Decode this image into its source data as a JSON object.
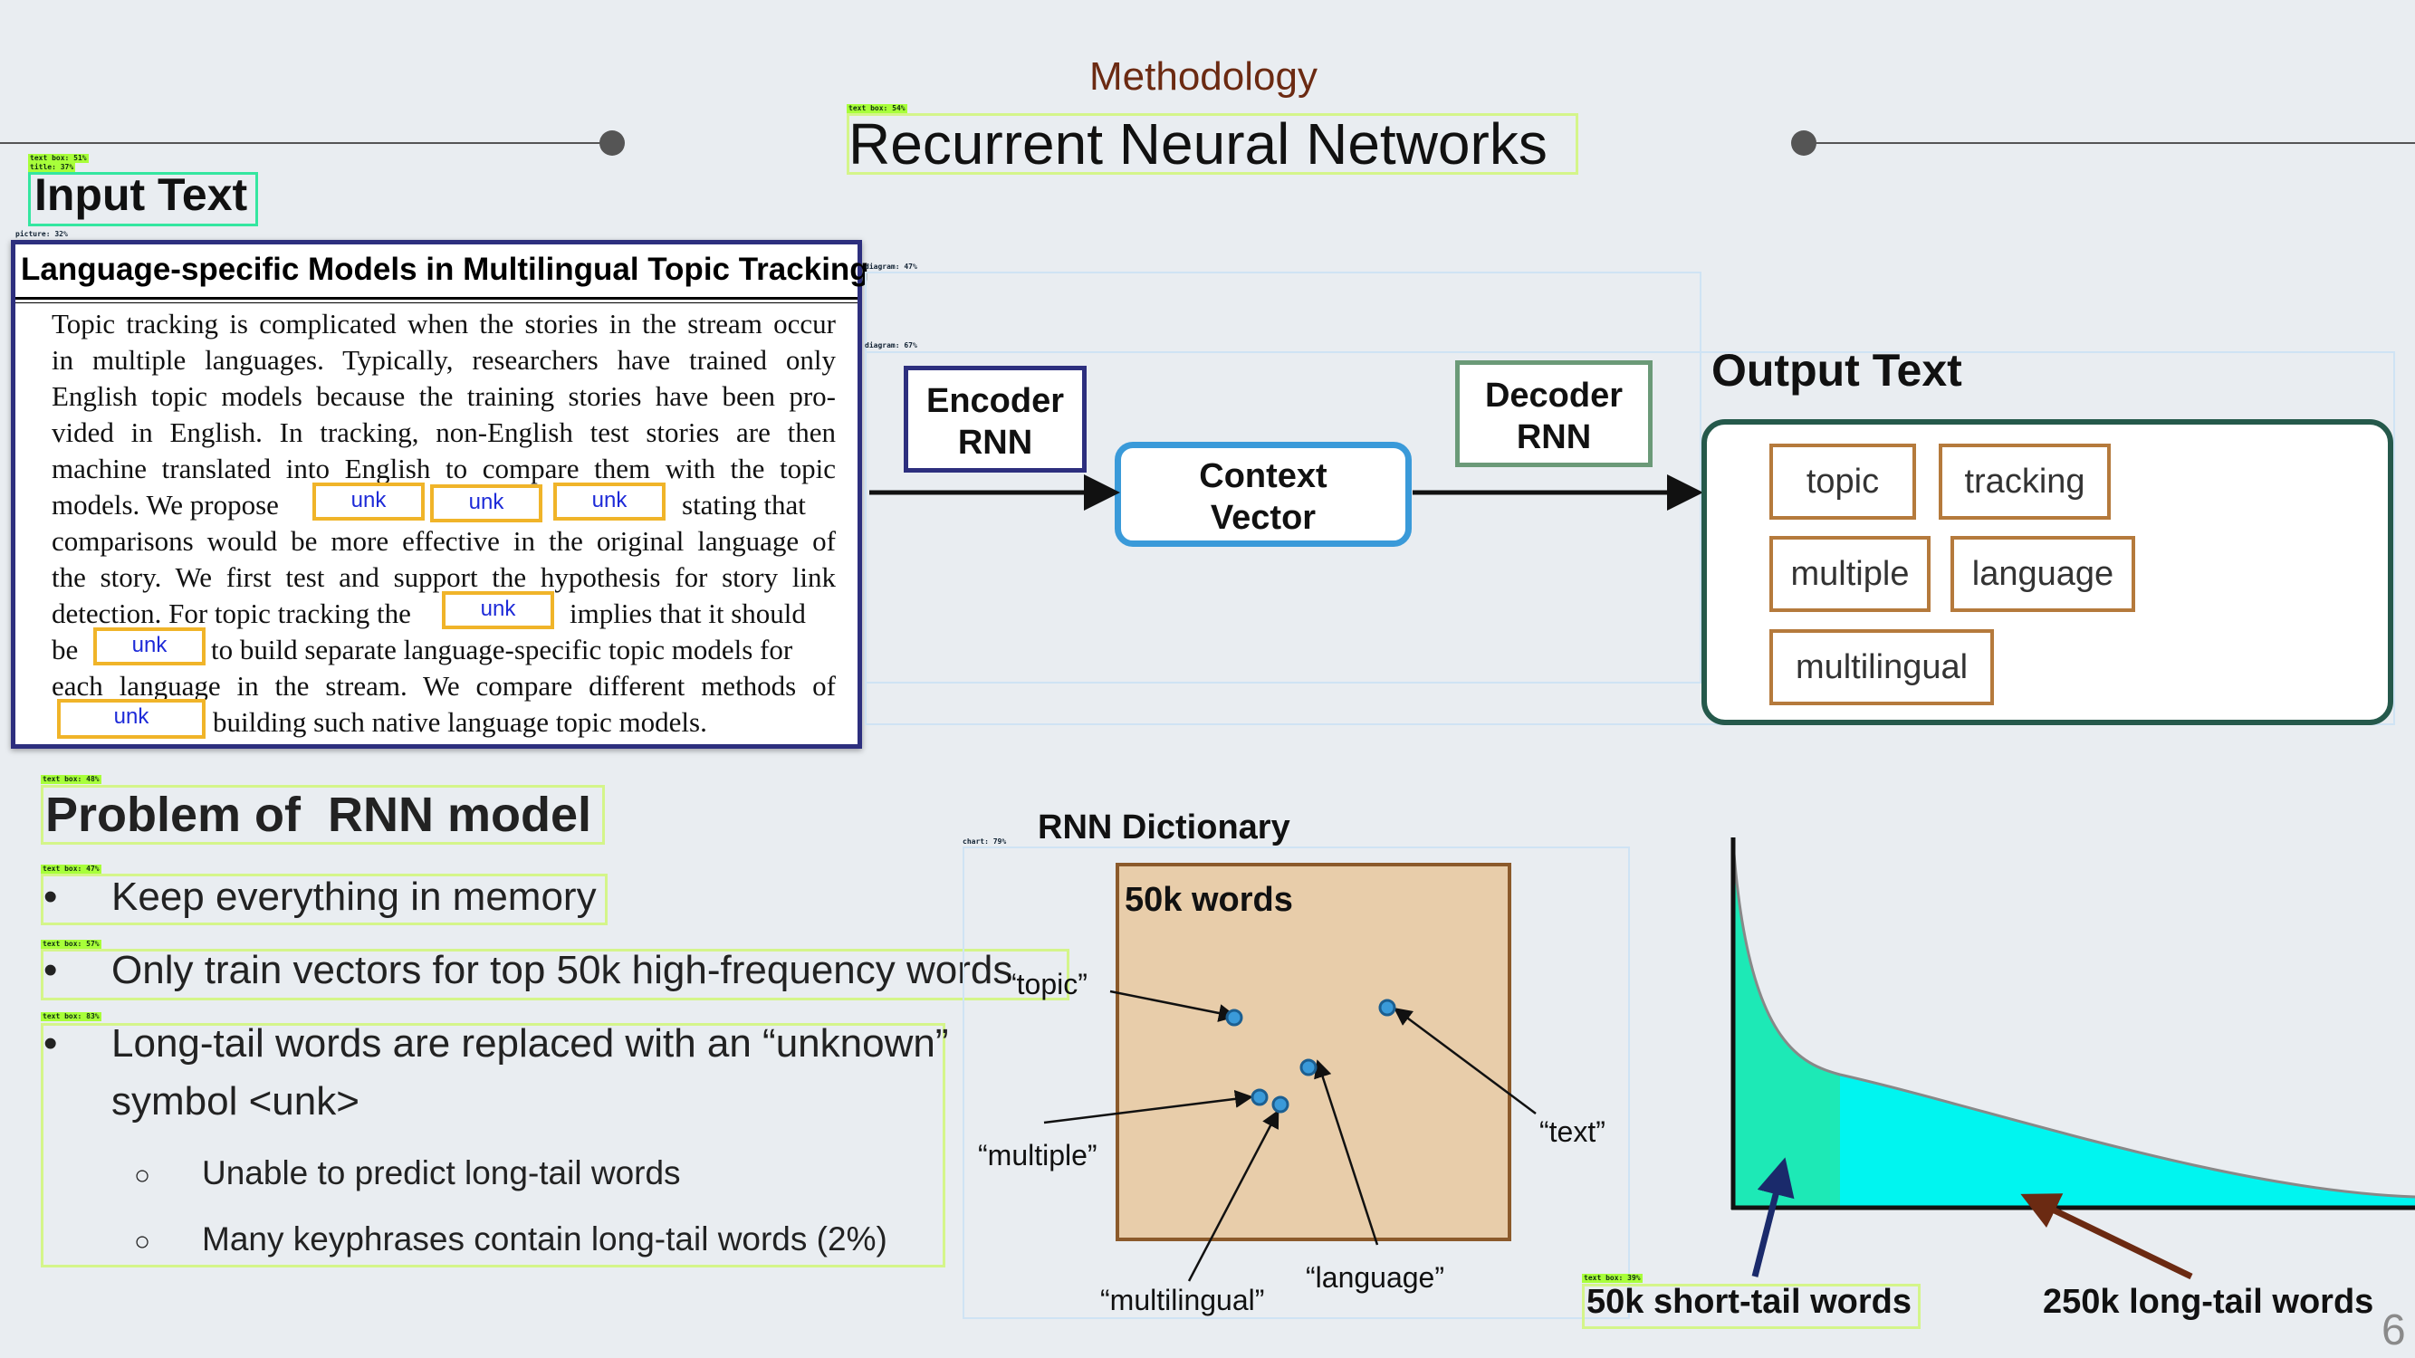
{
  "header": {
    "section": "Methodology",
    "title": "Recurrent Neural Networks"
  },
  "input": {
    "heading": "Input Text",
    "doc_title": "Language-specific Models in Multilingual Topic Tracking",
    "lines": [
      "Topic tracking is complicated when the stories in the stream occur",
      "in multiple languages. Typically, researchers have trained only",
      "English topic models because the training stories have been pro-",
      "vided in English. In tracking, non-English test stories are then",
      "machine translated into English to compare them with the topic",
      "models. We propose",
      "comparisons would be more effective in the original language of",
      "the story. We first test and support the hypothesis for story link",
      "detection. For topic tracking the",
      "be",
      "each language in the stream. We compare different methods of",
      "building such native language topic models."
    ],
    "fragments": {
      "stating_that": "stating that",
      "implies": "implies that it should",
      "to_build": "to build separate language-specific topic models for"
    },
    "unk_label": "unk"
  },
  "diagram": {
    "encoder": [
      "Encoder",
      "RNN"
    ],
    "decoder": [
      "Decoder",
      "RNN"
    ],
    "context": [
      "Context",
      "Vector"
    ],
    "output_heading": "Output Text",
    "output_words": [
      "topic",
      "tracking",
      "multiple",
      "language",
      "multilingual"
    ],
    "colors": {
      "encoder": "#2d2f7e",
      "decoder": "#6b9a78",
      "context": "#3a9ad9",
      "output": "#25594b",
      "word": "#b57a3c"
    }
  },
  "problem": {
    "heading": "Problem of  RNN model",
    "bullets": [
      "Keep everything in memory",
      "Only train vectors for top 50k high-frequency words",
      "Long-tail words are replaced with an “unknown”",
      "symbol <unk>"
    ],
    "sub_bullets": [
      "Unable to predict long-tail words",
      "Many keyphrases contain long-tail words (2%)"
    ],
    "bullet_glyph": "•",
    "sub_glyph": "○"
  },
  "dictionary": {
    "heading": "RNN Dictionary",
    "box_label": "50k words",
    "labels": {
      "topic": "“topic”",
      "text": "“text”",
      "multiple": "“multiple”",
      "language": "“language”",
      "multilingual": "“multilingual”"
    },
    "fill": "#e8cdaa",
    "point_color": "#3a9ad9"
  },
  "longtail": {
    "short_label": "50k short-tail words",
    "long_label": "250k long-tail words",
    "head_color": "#1de9b6",
    "tail_color": "#00f5f0"
  },
  "detections": {
    "text_box_51": "text box: 51%",
    "title_37": "title: 37%",
    "text_box_54": "text box: 54%",
    "picture_32": "picture: 32%",
    "diagram_47": "diagram: 47%",
    "diagram_67": "diagram: 67%",
    "text_box_48": "text box: 48%",
    "text_box_47": "text box: 47%",
    "text_box_57": "text box: 57%",
    "text_box_83": "text box: 83%",
    "chart_79": "chart: 79%",
    "text_box_39": "text box: 39%"
  },
  "page_number": "6"
}
